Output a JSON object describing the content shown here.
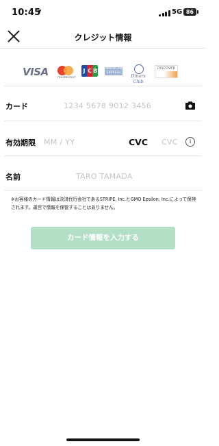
{
  "status_bar": {
    "time": "10:45",
    "network": "5G",
    "battery": "86"
  },
  "nav": {
    "title": "クレジット情報"
  },
  "card_brands": {
    "visa": "VISA",
    "mastercard": "mastercard",
    "jcb": [
      "J",
      "C",
      "B"
    ],
    "amex": "AMERICAN EXPRESS",
    "diners": "Diners Club",
    "discover": "DISCOVER"
  },
  "form": {
    "card": {
      "label": "カード",
      "placeholder": "1234 5678 9012 3456"
    },
    "expiry": {
      "label": "有効期限",
      "placeholder": "MM / YY"
    },
    "cvc": {
      "label": "CVC",
      "placeholder": "CVC",
      "info": "i"
    },
    "name": {
      "label": "名前",
      "placeholder": "TARO TAMADA"
    }
  },
  "notice": "※お客様のカード情報は決済代行会社であるSTRIPE, Inc.とGMO Epsilon, Inc.によって保持されます。運営で情報を保管することはありません。",
  "submit": {
    "label": "カード情報を入力する"
  },
  "colors": {
    "accent_disabled": "#b4dfc7",
    "placeholder": "#c4c4c4",
    "divider": "#e3e3e3"
  }
}
